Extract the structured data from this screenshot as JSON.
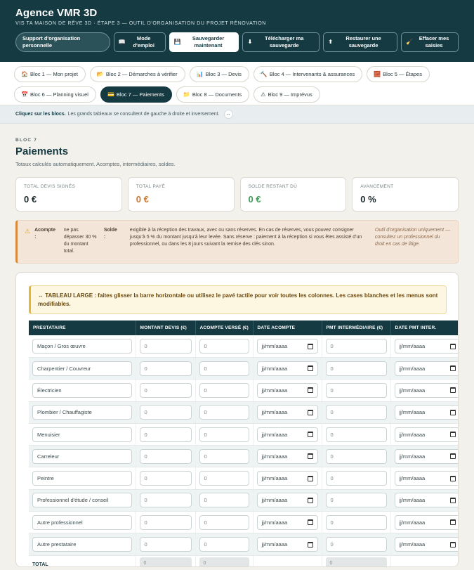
{
  "header": {
    "title": "Agence VMR 3D",
    "subtitle": "VIS TA MAISON DE RÊVE 3D · ÉTAPE 3 — OUTIL D'ORGANISATION DU PROJET RÉNOVATION",
    "buttons": [
      {
        "icon": "",
        "label": "Support d'organisation personnelle"
      },
      {
        "icon": "📖",
        "label": "Mode d'emploi"
      },
      {
        "icon": "💾",
        "label": "Sauvegarder maintenant"
      },
      {
        "icon": "⬇",
        "label": "Télécharger ma sauvegarde"
      },
      {
        "icon": "⬆",
        "label": "Restaurer une sauvegarde"
      },
      {
        "icon": "🧹",
        "label": "Effacer mes saisies"
      }
    ]
  },
  "tabs": [
    {
      "icon": "🏠",
      "label": "Bloc 1 — Mon projet"
    },
    {
      "icon": "📂",
      "label": "Bloc 2 — Démarches à vérifier"
    },
    {
      "icon": "📊",
      "label": "Bloc 3 — Devis"
    },
    {
      "icon": "🔨",
      "label": "Bloc 4 — Intervenants & assurances"
    },
    {
      "icon": "🧱",
      "label": "Bloc 5 — Étapes"
    },
    {
      "icon": "📅",
      "label": "Bloc 6 — Planning visuel"
    },
    {
      "icon": "💳",
      "label": "Bloc 7 — Paiements"
    },
    {
      "icon": "📁",
      "label": "Bloc 8 — Documents"
    },
    {
      "icon": "⚠",
      "label": "Bloc 9 — Imprévus"
    }
  ],
  "hint": {
    "bold": "Cliquez sur les blocs.",
    "text": "Les grands tableaux se consultent de gauche à droite et inversement.",
    "arrow": "↔"
  },
  "section": {
    "kicker": "BLOC 7",
    "title": "Paiements",
    "desc": "Totaux calculés automatiquement. Acomptes, intermédiaires, soldes."
  },
  "cards": [
    {
      "label": "TOTAL DEVIS SIGNÉS",
      "value": "0 €",
      "color": "#1d2b2e"
    },
    {
      "label": "TOTAL PAYÉ",
      "value": "0 €",
      "color": "#c8782c"
    },
    {
      "label": "SOLDE RESTANT DÛ",
      "value": "0 €",
      "color": "#3f9a5a"
    },
    {
      "label": "AVANCEMENT",
      "value": "0 %",
      "color": "#1d2b2e"
    }
  ],
  "notice": {
    "k1": "Acompte :",
    "t1": "ne pas dépasser 30 % du montant total.",
    "k2": "Solde :",
    "t2": "exigible à la réception des travaux, avec ou sans réserves. En cas de réserves, vous pouvez consigner jusqu'à 5 % du montant jusqu'à leur levée. Sans réserve : paiement à la réception si vous êtes assisté d'un professionnel, ou dans les 8 jours suivant la remise des clés sinon.",
    "t3": "Outil d'organisation uniquement — consultez un professionnel du droit en cas de litige."
  },
  "wide_notice": "↔ TABLEAU LARGE : faites glisser la barre horizontale ou utilisez le pavé tactile pour voir toutes les colonnes. Les cases blanches et les menus sont modifiables.",
  "table": {
    "columns": [
      "PRESTATAIRE",
      "MONTANT DEVIS (€)",
      "ACOMPTE VERSÉ (€)",
      "DATE ACOMPTE",
      "PMT INTERMÉDIAIRE (€)",
      "DATE PMT INTER."
    ],
    "placeholder_num": "0",
    "placeholder_date": "jj/mm/aaaa",
    "rows": [
      "Maçon / Gros œuvre",
      "Charpentier / Couvreur",
      "Électricien",
      "Plombier / Chauffagiste",
      "Menuisier",
      "Carreleur",
      "Peintre",
      "Professionnel d'étude / conseil",
      "Autre professionnel",
      "Autre prestataire"
    ],
    "total_label": "TOTAL",
    "total_values": [
      "0",
      "0",
      "0"
    ]
  }
}
